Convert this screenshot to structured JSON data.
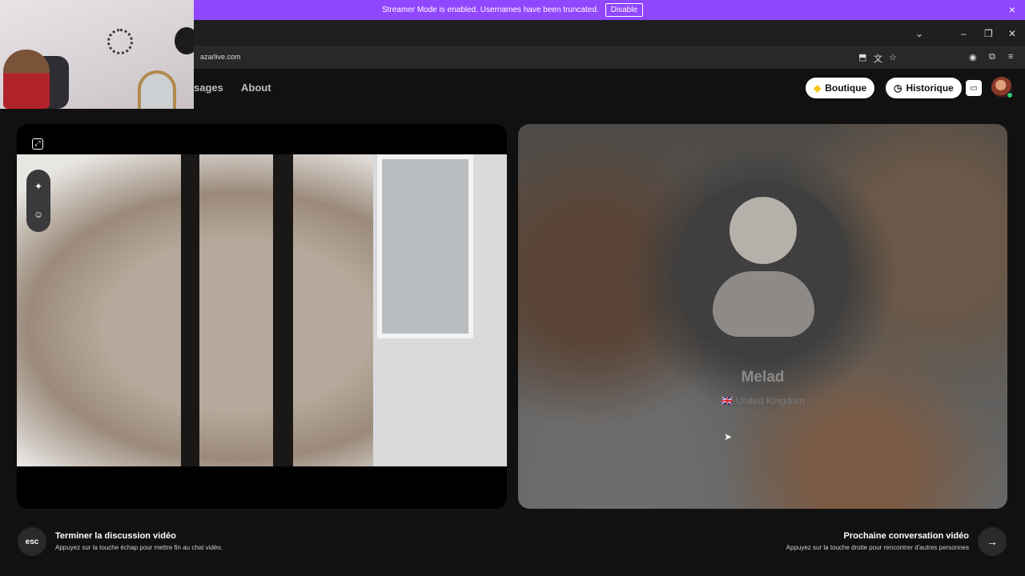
{
  "banner": {
    "message": "Streamer Mode is enabled. Usernames have been truncated.",
    "disable_label": "Disable",
    "close_icon": "×"
  },
  "browser": {
    "url": "azarlive.com",
    "controls": {
      "dropdown": "⌄",
      "minimize": "–",
      "restore": "❐",
      "close": "✕"
    }
  },
  "nav": {
    "messages_label": "sages",
    "about_label": "About"
  },
  "header_actions": {
    "boutique_label": "Boutique",
    "historique_label": "Historique"
  },
  "partner": {
    "name": "Melad",
    "country": "🇬🇧 United Kingdom"
  },
  "bottom": {
    "esc_label": "esc",
    "end_title": "Terminer la discussion vidéo",
    "end_sub": "Appuyez sur la touche échap pour mettre fin au chat vidéo.",
    "next_title": "Prochaine conversation vidéo",
    "next_sub": "Appuyez sur la touche droite pour rencontrer d'autres personnes"
  },
  "colors": {
    "banner": "#9146ff",
    "background": "#111112"
  }
}
